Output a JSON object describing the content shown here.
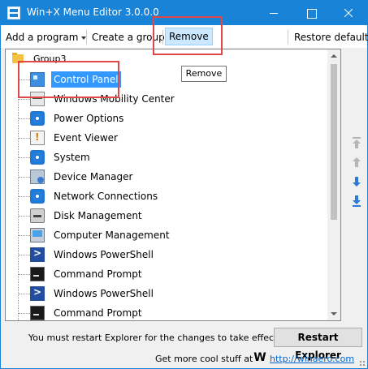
{
  "window": {
    "title": "Win+X Menu Editor 3.0.0.0"
  },
  "toolbar": {
    "add_program_label": "Add a program",
    "create_group_label": "Create a group",
    "remove_label": "Remove",
    "restore_label": "Restore defaults"
  },
  "tooltip": {
    "text": "Remove"
  },
  "tree": {
    "group_label": "Group3",
    "items": [
      {
        "label": "Control Panel",
        "icon": "control-panel-icon",
        "selected": true
      },
      {
        "label": "Windows Mobility Center",
        "icon": "mobility-center-icon"
      },
      {
        "label": "Power Options",
        "icon": "gear-icon"
      },
      {
        "label": "Event Viewer",
        "icon": "event-viewer-icon"
      },
      {
        "label": "System",
        "icon": "gear-icon"
      },
      {
        "label": "Device Manager",
        "icon": "device-manager-icon"
      },
      {
        "label": "Network Connections",
        "icon": "gear-icon"
      },
      {
        "label": "Disk Management",
        "icon": "disk-icon"
      },
      {
        "label": "Computer Management",
        "icon": "computer-icon"
      },
      {
        "label": "Windows PowerShell",
        "icon": "powershell-icon"
      },
      {
        "label": "Command Prompt",
        "icon": "command-prompt-icon"
      },
      {
        "label": "Windows PowerShell",
        "icon": "powershell-icon"
      },
      {
        "label": "Command Prompt",
        "icon": "command-prompt-icon"
      }
    ]
  },
  "footer": {
    "restart_message": "You must restart Explorer for the changes to take effect.",
    "restart_button_label": "Restart Explorer",
    "more_stuff_text": "Get more cool stuff at",
    "logo_letter": "W",
    "link_text": "http://winaero.com"
  },
  "colors": {
    "titlebar": "#1883d7",
    "selection": "#3399ff",
    "annotation_red": "#e04848"
  }
}
